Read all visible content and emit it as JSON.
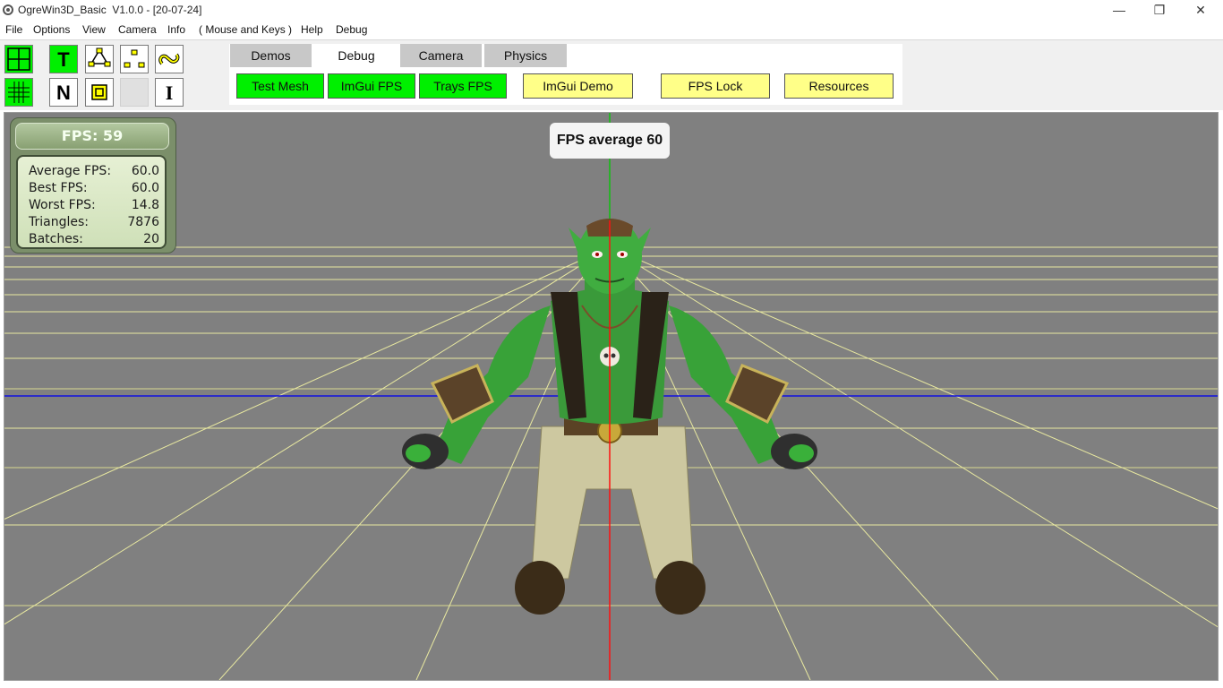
{
  "window": {
    "title": "OgreWin3D_Basic  V1.0.0 - [20-07-24]",
    "controls": [
      "minimize",
      "restore",
      "close"
    ]
  },
  "menu": {
    "items": [
      "File",
      "Options",
      "View",
      "Camera",
      "Info",
      "( Mouse and Keys )",
      "Help",
      "Debug"
    ]
  },
  "toolbar": {
    "buttons": [
      {
        "name": "grid-large-icon",
        "label": ""
      },
      {
        "name": "text-toggle-icon",
        "label": "T"
      },
      {
        "name": "bones-icon",
        "label": ""
      },
      {
        "name": "points-icon",
        "label": ""
      },
      {
        "name": "link-icon",
        "label": ""
      },
      {
        "name": "grid-small-icon",
        "label": ""
      },
      {
        "name": "normals-icon",
        "label": "N"
      },
      {
        "name": "bounding-box-icon",
        "label": ""
      },
      {
        "name": "blank-icon",
        "label": ""
      },
      {
        "name": "info-icon",
        "label": "I"
      }
    ],
    "accent_green": "#00f000",
    "accent_yellow": "#ffff88"
  },
  "tabs": {
    "items": [
      "Demos",
      "Debug",
      "Camera",
      "Physics"
    ],
    "active": "Debug",
    "debug_buttons": [
      {
        "label": "Test Mesh",
        "color": "green"
      },
      {
        "label": "ImGui FPS",
        "color": "green"
      },
      {
        "label": "Trays FPS",
        "color": "green"
      },
      {
        "label": "ImGui Demo",
        "color": "yellow"
      },
      {
        "label": "FPS Lock",
        "color": "yellow"
      },
      {
        "label": "Resources",
        "color": "yellow"
      }
    ]
  },
  "stats_panel": {
    "header": "FPS: 59",
    "rows": [
      {
        "label": "Average FPS:",
        "value": "60.0"
      },
      {
        "label": "Best FPS:",
        "value": "60.0"
      },
      {
        "label": "Worst FPS:",
        "value": "14.8"
      },
      {
        "label": "Triangles:",
        "value": "7876"
      },
      {
        "label": "Batches:",
        "value": "20"
      }
    ]
  },
  "overlay": {
    "fps_average": "FPS average 60"
  },
  "scene": {
    "background": "#808080",
    "axis_colors": {
      "x": "#0000ff",
      "y": "#00ff00",
      "z": "#ff0000"
    },
    "grid_color": "#ffff66",
    "model": "green-ogre-character"
  }
}
